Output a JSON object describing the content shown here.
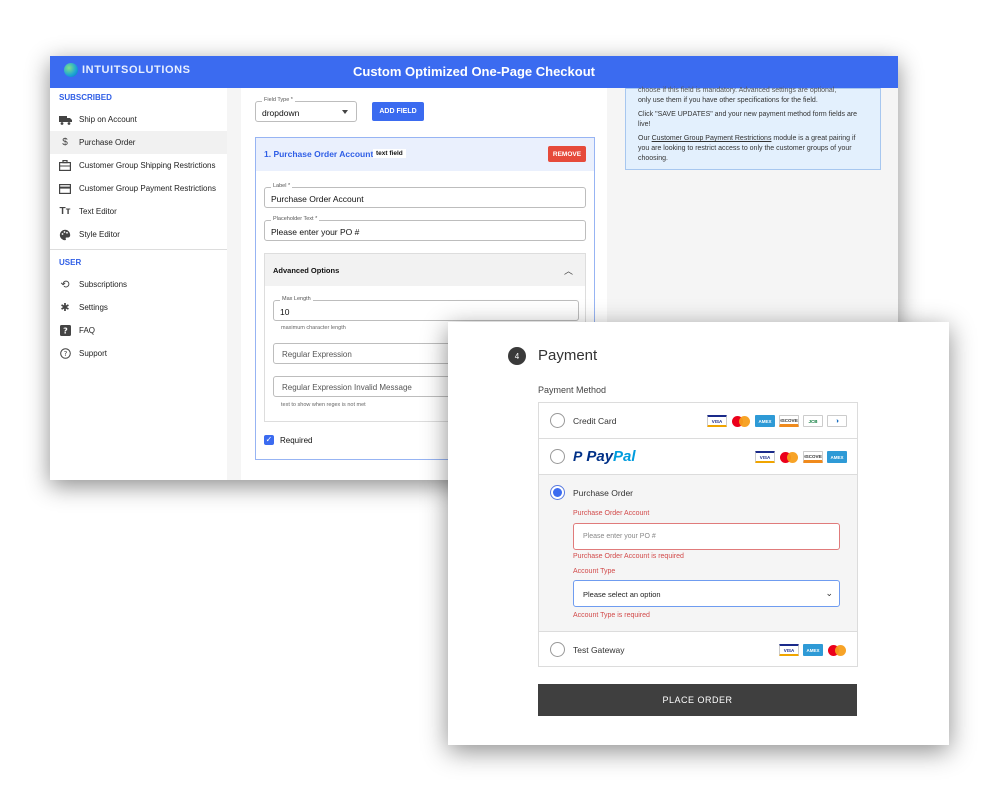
{
  "admin": {
    "brand": "INTUITSOLUTIONS",
    "title": "Custom Optimized One-Page Checkout",
    "sidebar": {
      "section_subscribed": "SUBSCRIBED",
      "section_user": "USER",
      "subscribed_items": [
        {
          "label": "Ship on Account",
          "icon": "truck-icon"
        },
        {
          "label": "Purchase Order",
          "icon": "dollar-icon"
        },
        {
          "label": "Customer Group Shipping Restrictions",
          "icon": "briefcase-icon"
        },
        {
          "label": "Customer Group Payment Restrictions",
          "icon": "credit-card-icon"
        },
        {
          "label": "Text Editor",
          "icon": "text-size-icon"
        },
        {
          "label": "Style Editor",
          "icon": "palette-icon"
        }
      ],
      "user_items": [
        {
          "label": "Subscriptions",
          "icon": "refresh-icon"
        },
        {
          "label": "Settings",
          "icon": "gear-icon"
        },
        {
          "label": "FAQ",
          "icon": "question-box-icon"
        },
        {
          "label": "Support",
          "icon": "help-circle-icon"
        }
      ]
    },
    "editor": {
      "field_type_label": "Field Type *",
      "field_type_value": "dropdown",
      "add_field_label": "ADD FIELD",
      "card_title": "1. Purchase Order Account",
      "card_type_chip": "text field",
      "remove_label": "REMOVE",
      "label_label": "Label *",
      "label_value": "Purchase Order Account",
      "placeholder_label": "Placeholder Text *",
      "placeholder_value": "Please enter your PO #",
      "advanced_title": "Advanced Options",
      "max_length_label": "Max Length",
      "max_length_value": "10",
      "max_length_helper": "maximum character length",
      "regex_placeholder": "Regular Expression",
      "regex_msg_placeholder": "Regular Expression Invalid Message",
      "regex_msg_helper": "text to show when regex is not met",
      "required_label": "Required"
    },
    "help": {
      "line_top": "choose if this field is mandatory. Advanced settings are optional,",
      "line_1": "only use them if you have other specifications for the field.",
      "line_2": "Click \"SAVE UPDATES\" and your new payment method form fields are live!",
      "line_3_prefix": "Our ",
      "line_3_link": "Customer Group Payment Restrictions",
      "line_3_suffix": " module is a great pairing if you are looking to restrict access to only the customer groups of your choosing."
    }
  },
  "payment": {
    "step_number": "4",
    "heading": "Payment",
    "method_label": "Payment Method",
    "options": {
      "credit_card": "Credit Card",
      "paypal_a": "Pay",
      "paypal_b": "Pal",
      "purchase_order": "Purchase Order",
      "test_gateway": "Test Gateway"
    },
    "selected_option": "Purchase Order",
    "po_account_label": "Purchase Order Account",
    "po_account_placeholder": "Please enter your PO #",
    "po_account_error": "Purchase Order Account is required",
    "account_type_label": "Account Type",
    "account_type_value": "Please select an option",
    "account_type_error": "Account Type is required",
    "place_order_label": "PLACE ORDER",
    "card_logos": {
      "visa": "VISA",
      "amex": "AMEX",
      "discover": "DISCOVER",
      "jcb": "JCB",
      "diners": "◑"
    }
  },
  "colors": {
    "brand_blue": "#3b6bf0",
    "remove_red": "#e64a3b",
    "error_red": "#d24a4a",
    "button_dark": "#3f3f3f"
  }
}
